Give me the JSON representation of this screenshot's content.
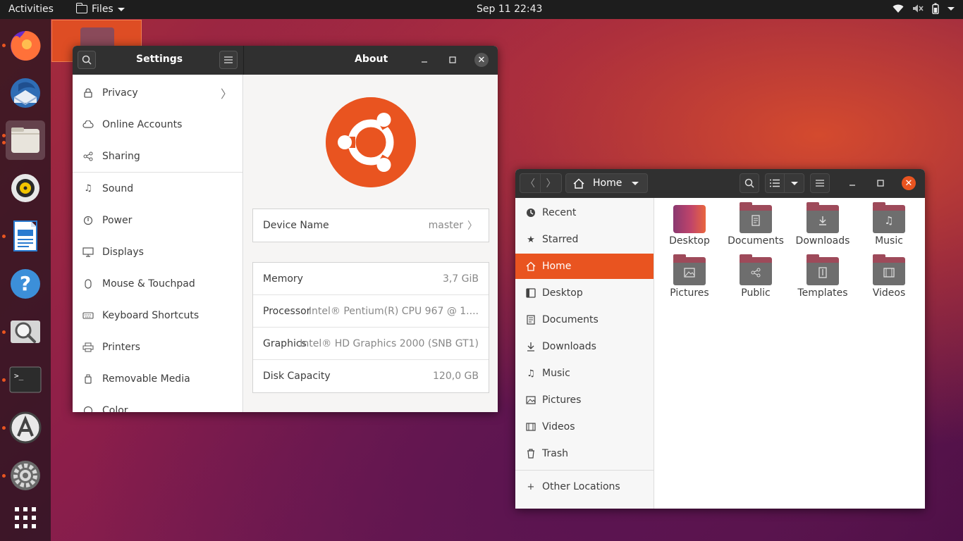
{
  "topbar": {
    "activities": "Activities",
    "app_menu": "Files",
    "clock": "Sep 11  22:43"
  },
  "dock": {
    "items": [
      {
        "name": "firefox",
        "color": "#ff7139"
      },
      {
        "name": "thunderbird",
        "color": "#2f6db5"
      },
      {
        "name": "files",
        "color": "#e8e4dc"
      },
      {
        "name": "rhythmbox",
        "color": "#f2c400"
      },
      {
        "name": "libreoffice-writer",
        "color": "#2a7bd0"
      },
      {
        "name": "help",
        "color": "#3c8fd9"
      },
      {
        "name": "screenshot",
        "color": "#c9c9c9"
      },
      {
        "name": "terminal",
        "color": "#2c2c2c"
      },
      {
        "name": "software",
        "color": "#e9e9e9"
      },
      {
        "name": "settings",
        "color": "#8a8a8a"
      }
    ]
  },
  "settings": {
    "title": "Settings",
    "panel_title": "About",
    "sidebar": {
      "items": [
        {
          "label": "Privacy",
          "icon": "lock-icon",
          "chevron": true
        },
        {
          "label": "Online Accounts",
          "icon": "cloud-icon"
        },
        {
          "label": "Sharing",
          "icon": "share-icon"
        },
        {
          "label": "Sound",
          "icon": "music-note-icon"
        },
        {
          "label": "Power",
          "icon": "power-icon"
        },
        {
          "label": "Displays",
          "icon": "display-icon"
        },
        {
          "label": "Mouse & Touchpad",
          "icon": "mouse-icon"
        },
        {
          "label": "Keyboard Shortcuts",
          "icon": "keyboard-icon"
        },
        {
          "label": "Printers",
          "icon": "printer-icon"
        },
        {
          "label": "Removable Media",
          "icon": "usb-icon"
        },
        {
          "label": "Color",
          "icon": "color-icon"
        }
      ]
    },
    "about": {
      "device_name_label": "Device Name",
      "device_name_value": "master",
      "memory_label": "Memory",
      "memory_value": "3,7 GiB",
      "processor_label": "Processor",
      "processor_value": "Intel® Pentium(R) CPU 967 @ 1....",
      "graphics_label": "Graphics",
      "graphics_value": "Intel® HD Graphics 2000 (SNB GT1)",
      "disk_label": "Disk Capacity",
      "disk_value": "120,0 GB"
    }
  },
  "files": {
    "path_label": "Home",
    "places": [
      {
        "label": "Recent",
        "icon": "clock-icon"
      },
      {
        "label": "Starred",
        "icon": "star-icon"
      },
      {
        "label": "Home",
        "icon": "home-icon",
        "selected": true
      },
      {
        "label": "Desktop",
        "icon": "desktop-icon"
      },
      {
        "label": "Documents",
        "icon": "document-icon"
      },
      {
        "label": "Downloads",
        "icon": "download-icon"
      },
      {
        "label": "Music",
        "icon": "music-icon"
      },
      {
        "label": "Pictures",
        "icon": "picture-icon"
      },
      {
        "label": "Videos",
        "icon": "video-icon"
      },
      {
        "label": "Trash",
        "icon": "trash-icon"
      },
      {
        "label": "Other Locations",
        "icon": "plus-icon"
      }
    ],
    "folders": [
      {
        "label": "Desktop",
        "icon": "desktop-folder-icon"
      },
      {
        "label": "Documents",
        "icon": "documents-folder-icon"
      },
      {
        "label": "Downloads",
        "icon": "downloads-folder-icon"
      },
      {
        "label": "Music",
        "icon": "music-folder-icon"
      },
      {
        "label": "Pictures",
        "icon": "pictures-folder-icon"
      },
      {
        "label": "Public",
        "icon": "public-folder-icon"
      },
      {
        "label": "Templates",
        "icon": "templates-folder-icon"
      },
      {
        "label": "Videos",
        "icon": "videos-folder-icon"
      }
    ]
  },
  "colors": {
    "accent": "#e95420",
    "headerbar": "#303030",
    "topbar": "#1d1d1d"
  }
}
